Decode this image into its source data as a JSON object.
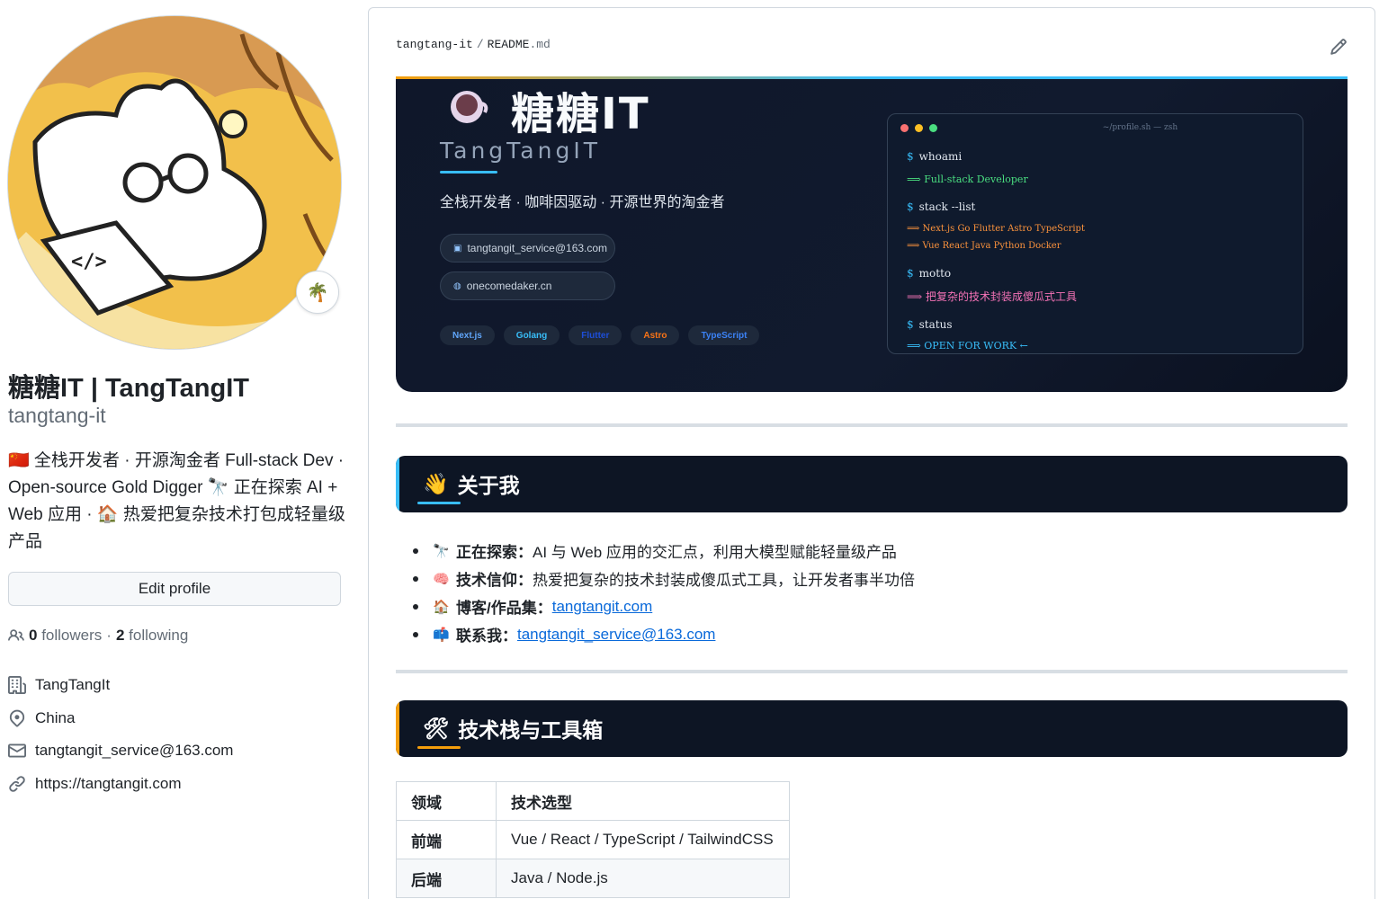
{
  "profile": {
    "display_name": "糖糖IT | TangTangIT",
    "login": "tangtang-it",
    "status_emoji": "🌴",
    "bio": "🇨🇳 全栈开发者 · 开源淘金者 Full-stack Dev · Open-source Gold Digger 🔭 正在探索 AI + Web 应用 · 🏠 热爱把复杂技术打包成轻量级产品",
    "edit_button": "Edit profile",
    "followers_count": "0",
    "followers_label": "followers",
    "separator": "·",
    "following_count": "2",
    "following_label": "following",
    "company": "TangTangIt",
    "location": "China",
    "email": "tangtangit_service@163.com",
    "website": "https://tangtangit.com"
  },
  "readme": {
    "owner": "tangtang-it",
    "separator": "/",
    "file_name": "README",
    "file_ext": ".md",
    "hero": {
      "title": "糖糖IT",
      "subtitle": "TangTangIT",
      "tagline": "全栈开发者 · 咖啡因驱动 · 开源世界的淘金者",
      "email": "tangtangit_service@163.com",
      "website": "onecomedaker.cn",
      "badges": [
        {
          "label": "Next.js",
          "color": "#60a5fa"
        },
        {
          "label": "Golang",
          "color": "#38bdf8"
        },
        {
          "label": "Flutter",
          "color": "#1d4ed8"
        },
        {
          "label": "Astro",
          "color": "#f97316"
        },
        {
          "label": "TypeScript",
          "color": "#3b82f6"
        }
      ],
      "terminal": {
        "title": "~/profile.sh — zsh",
        "prompt": "$",
        "arrow": "⟹",
        "cmd1": "whoami",
        "out1": "Full-stack Developer",
        "cmd2": "stack --list",
        "out2a": "Next.js Go Flutter Astro TypeScript",
        "out2b": "Vue React Java Python Docker",
        "cmd3": "motto",
        "out3": "把复杂的技术封装成傻瓜式工具",
        "cmd4": "status",
        "out4": "OPEN FOR WORK ←",
        "colors": {
          "green": "#4ade80",
          "orange": "#fb923c",
          "pink": "#f472b6",
          "blue": "#38bdf8"
        }
      }
    },
    "about": {
      "emoji": "👋",
      "title": "关于我",
      "items": [
        {
          "emoji": "🔭",
          "label": "正在探索：",
          "text": "AI 与 Web 应用的交汇点，利用大模型赋能轻量级产品"
        },
        {
          "emoji": "🧠",
          "label": "技术信仰：",
          "text": "热爱把复杂的技术封装成傻瓜式工具，让开发者事半功倍"
        },
        {
          "emoji": "🏠",
          "label": "博客/作品集：",
          "link": "tangtangit.com"
        },
        {
          "emoji": "📫",
          "label": "联系我：",
          "link": "tangtangit_service@163.com"
        }
      ]
    },
    "stack": {
      "emoji": "🛠",
      "title": "技术栈与工具箱",
      "headers": [
        "领域",
        "技术选型"
      ],
      "rows": [
        [
          "前端",
          "Vue / React / TypeScript / TailwindCSS"
        ],
        [
          "后端",
          "Java / Node.js"
        ]
      ]
    }
  }
}
